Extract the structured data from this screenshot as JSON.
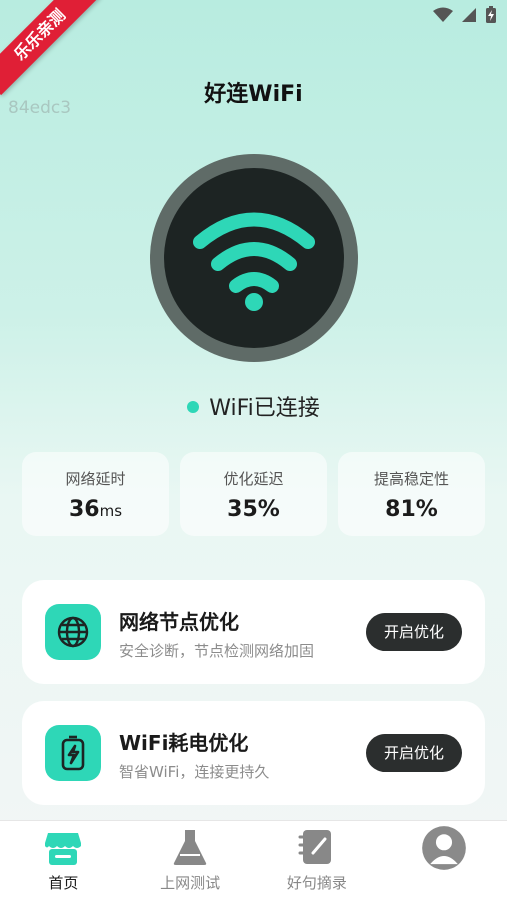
{
  "statusbar": {
    "icons": [
      "wifi-icon",
      "signal-icon",
      "battery-icon"
    ]
  },
  "ribbon": {
    "label": "乐乐亲测"
  },
  "debug": {
    "id": "84edc3"
  },
  "header": {
    "title": "好连WiFi"
  },
  "hero": {
    "icon": "wifi-icon",
    "accent": "#2ed7b7"
  },
  "status": {
    "text": "WiFi已连接"
  },
  "stats": [
    {
      "label": "网络延时",
      "value": "36",
      "unit": "ms"
    },
    {
      "label": "优化延迟",
      "value": "35%",
      "unit": ""
    },
    {
      "label": "提高稳定性",
      "value": "81%",
      "unit": ""
    }
  ],
  "cards": [
    {
      "title": "网络节点优化",
      "subtitle": "安全诊断，节点检测网络加固",
      "button": "开启优化",
      "icon": "globe-icon"
    },
    {
      "title": "WiFi耗电优化",
      "subtitle": "智省WiFi，连接更持久",
      "button": "开启优化",
      "icon": "battery-bolt-icon"
    }
  ],
  "tabs": [
    {
      "label": "首页",
      "icon": "store-icon",
      "active": true
    },
    {
      "label": "上网测试",
      "icon": "flask-icon",
      "active": false
    },
    {
      "label": "好句摘录",
      "icon": "notebook-icon",
      "active": false
    },
    {
      "label": "",
      "icon": "avatar-icon",
      "active": false
    }
  ]
}
